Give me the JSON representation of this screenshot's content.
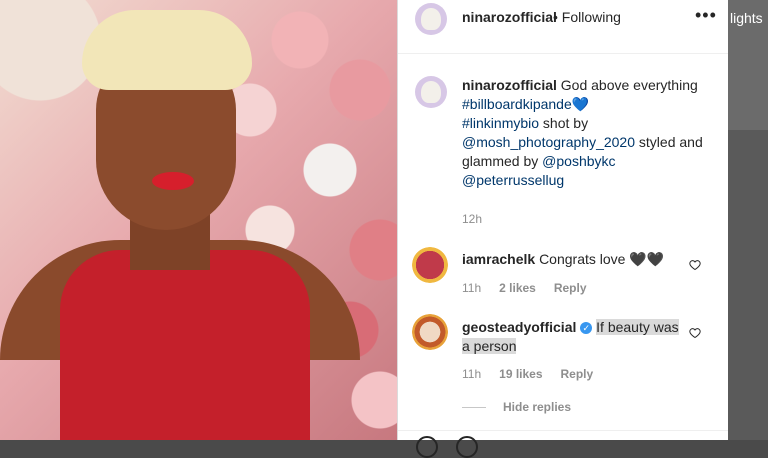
{
  "post": {
    "username": "ninarozofficial",
    "follow_status": "Following",
    "more_label": "•••"
  },
  "caption": {
    "username": "ninarozofficial",
    "text_line1": "God above everything",
    "emoji1": "",
    "hashtag1": "#billboardkipande",
    "hashtag1_emoji": "💙",
    "hashtag2": "#linkinmybio",
    "text2": " shot by",
    "mention1": "@mosh_photography_2020",
    "text3": " styled and glammed by ",
    "mention2": "@poshbykc",
    "mention3": "@peterrussellug",
    "emoji2": "",
    "time": "12h"
  },
  "comments": [
    {
      "username": "iamrachelk",
      "text": "Congrats love ",
      "emoji": "🖤🖤",
      "time": "11h",
      "likes": "2 likes",
      "reply_label": "Reply"
    },
    {
      "username": "geosteadyofficial",
      "verified": "✓",
      "text_line1": "If beauty was",
      "text_line2": "a person",
      "time": "11h",
      "likes": "19 likes",
      "reply_label": "Reply"
    }
  ],
  "hide_replies_label": "Hide replies",
  "side_text": "lights",
  "icons": {
    "more": "more-icon",
    "heart": "heart-outline-icon",
    "verified": "verified-badge-icon"
  },
  "colors": {
    "link": "#00376b",
    "muted": "#8e8e8e",
    "verified": "#3897f0",
    "highlight": "#dadada"
  }
}
